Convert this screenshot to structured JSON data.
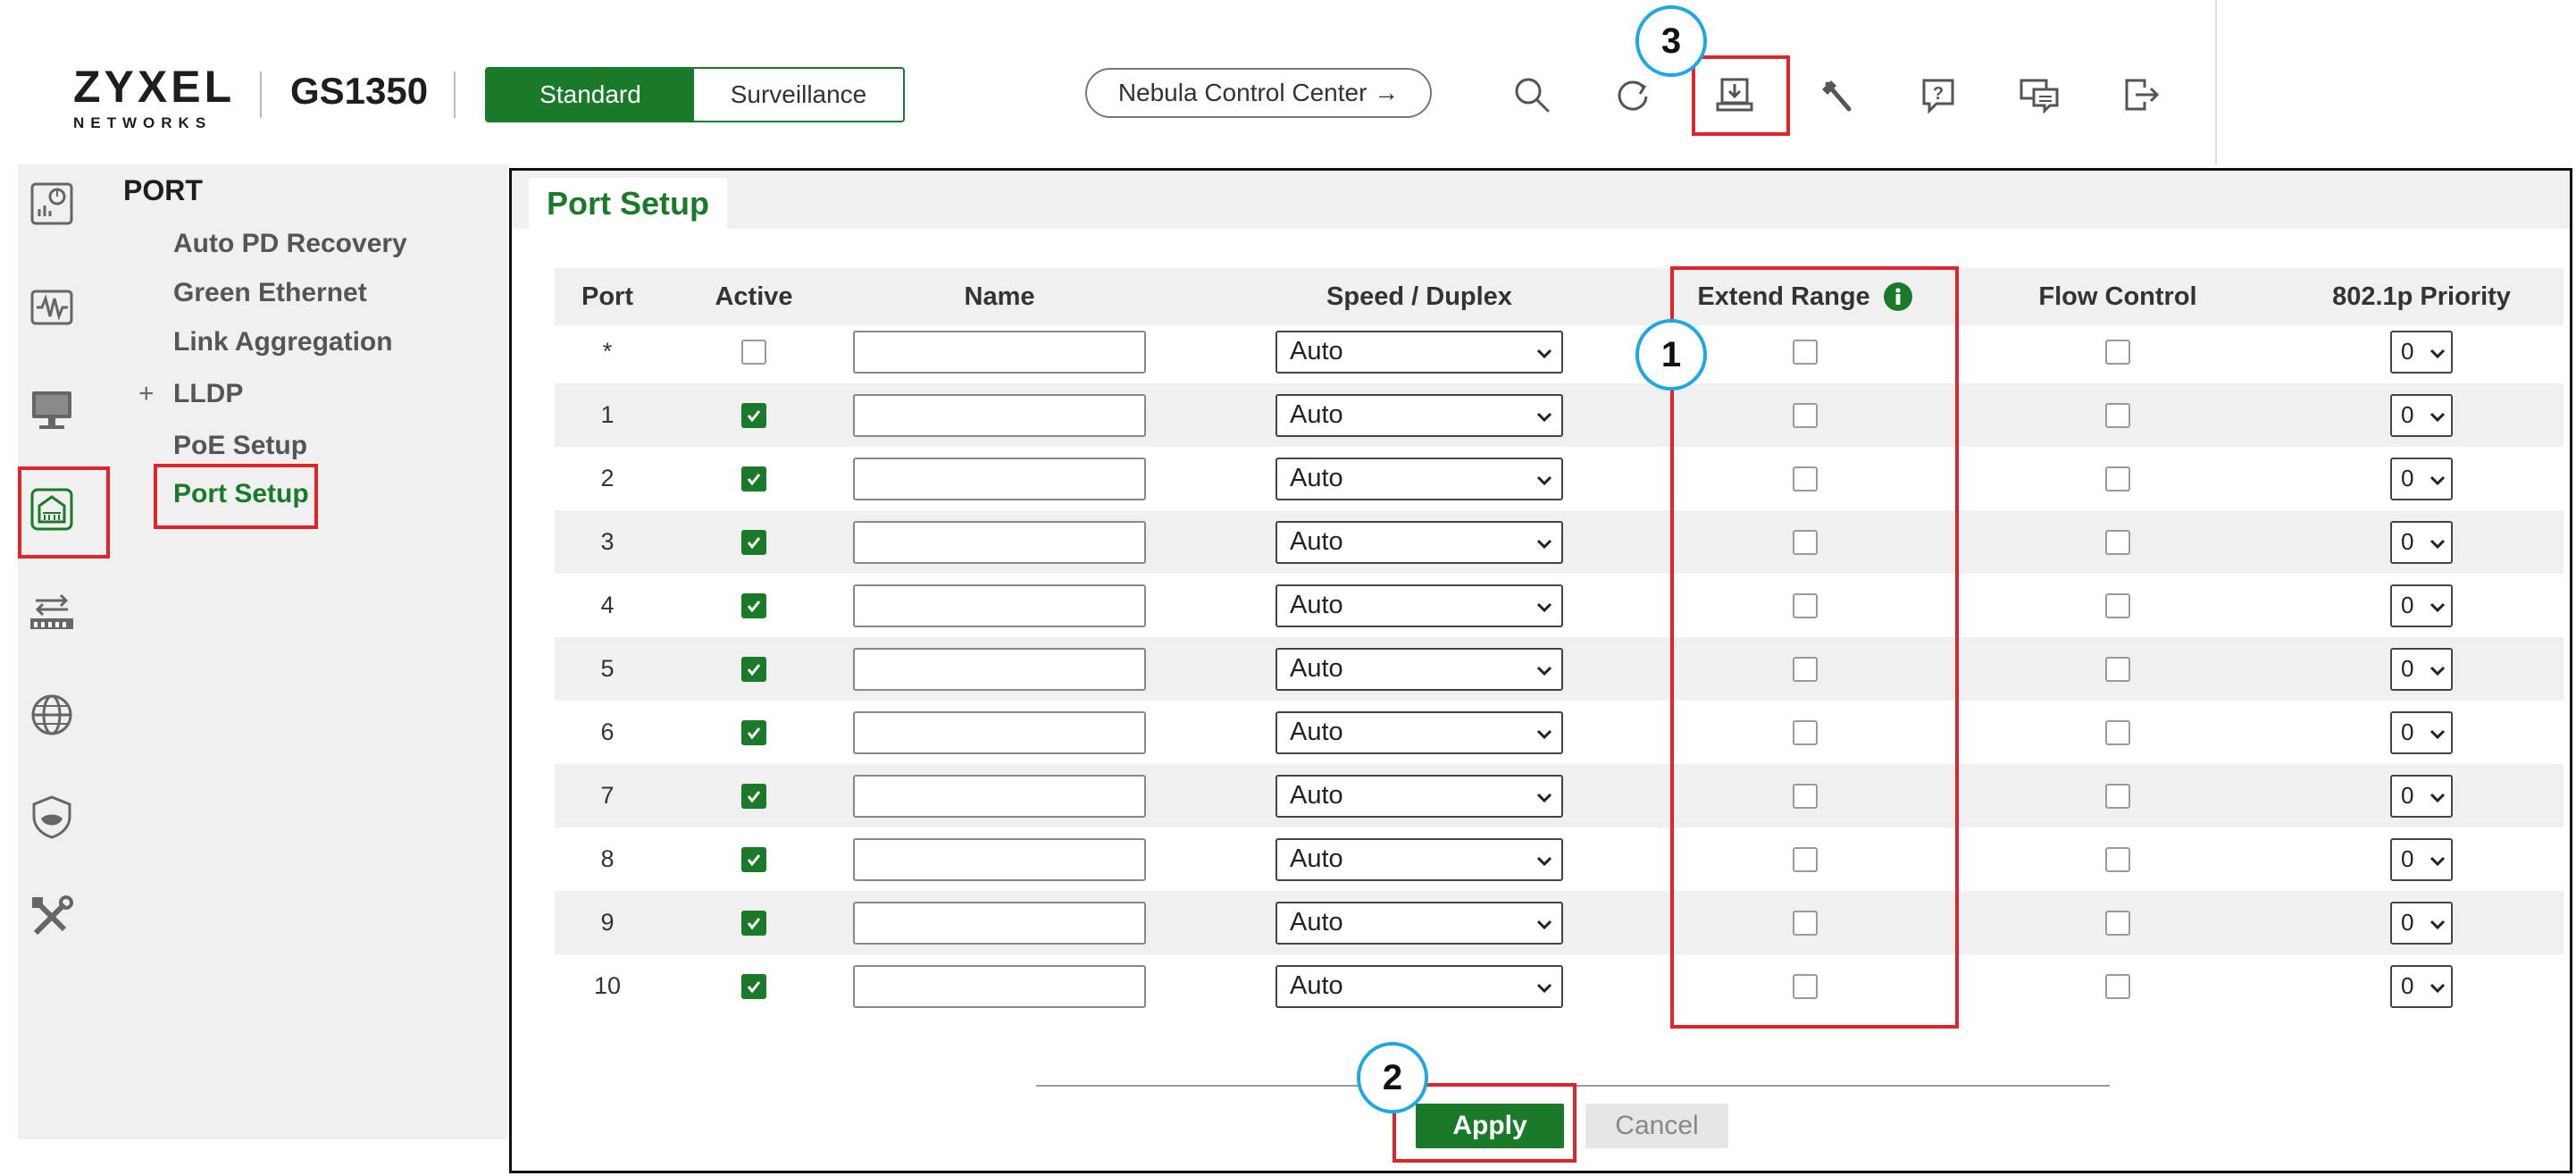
{
  "header": {
    "logo_main": "ZYXEL",
    "logo_sub": "NETWORKS",
    "model": "GS1350",
    "mode_standard": "Standard",
    "mode_surveillance": "Surveillance",
    "ncc_label": "Nebula Control Center →",
    "toolbar_icons": [
      "search-icon",
      "refresh-icon",
      "save-icon",
      "tools-icon",
      "help-icon",
      "feedback-icon",
      "logout-icon"
    ]
  },
  "rail_icons": [
    "dashboard-icon",
    "monitor-icon",
    "system-icon",
    "port-icon",
    "switching-icon",
    "network-icon",
    "security-icon",
    "maintenance-icon"
  ],
  "sidenav": {
    "heading": "PORT",
    "items": [
      {
        "label": "Auto PD Recovery"
      },
      {
        "label": "Green Ethernet"
      },
      {
        "label": "Link Aggregation"
      },
      {
        "label": "LLDP",
        "expand": "+"
      },
      {
        "label": "PoE Setup"
      },
      {
        "label": "Port Setup"
      }
    ]
  },
  "tab": {
    "label": "Port Setup"
  },
  "table": {
    "headers": [
      "Port",
      "Active",
      "Name",
      "Speed / Duplex",
      "Extend Range",
      "Flow Control",
      "802.1p Priority"
    ],
    "rows": [
      {
        "port": "*",
        "active": false,
        "name": "",
        "speed": "Auto",
        "extend": false,
        "flow": false,
        "priority": "0"
      },
      {
        "port": "1",
        "active": true,
        "name": "",
        "speed": "Auto",
        "extend": false,
        "flow": false,
        "priority": "0"
      },
      {
        "port": "2",
        "active": true,
        "name": "",
        "speed": "Auto",
        "extend": false,
        "flow": false,
        "priority": "0"
      },
      {
        "port": "3",
        "active": true,
        "name": "",
        "speed": "Auto",
        "extend": false,
        "flow": false,
        "priority": "0"
      },
      {
        "port": "4",
        "active": true,
        "name": "",
        "speed": "Auto",
        "extend": false,
        "flow": false,
        "priority": "0"
      },
      {
        "port": "5",
        "active": true,
        "name": "",
        "speed": "Auto",
        "extend": false,
        "flow": false,
        "priority": "0"
      },
      {
        "port": "6",
        "active": true,
        "name": "",
        "speed": "Auto",
        "extend": false,
        "flow": false,
        "priority": "0"
      },
      {
        "port": "7",
        "active": true,
        "name": "",
        "speed": "Auto",
        "extend": false,
        "flow": false,
        "priority": "0"
      },
      {
        "port": "8",
        "active": true,
        "name": "",
        "speed": "Auto",
        "extend": false,
        "flow": false,
        "priority": "0"
      },
      {
        "port": "9",
        "active": true,
        "name": "",
        "speed": "Auto",
        "extend": false,
        "flow": false,
        "priority": "0"
      },
      {
        "port": "10",
        "active": true,
        "name": "",
        "speed": "Auto",
        "extend": false,
        "flow": false,
        "priority": "0"
      }
    ]
  },
  "buttons": {
    "apply": "Apply",
    "cancel": "Cancel"
  },
  "callouts": [
    "1",
    "2",
    "3"
  ],
  "colors": {
    "brand_green": "#1b7a2a",
    "highlight_red": "#e0242b",
    "callout_blue": "#1ea7e0"
  }
}
